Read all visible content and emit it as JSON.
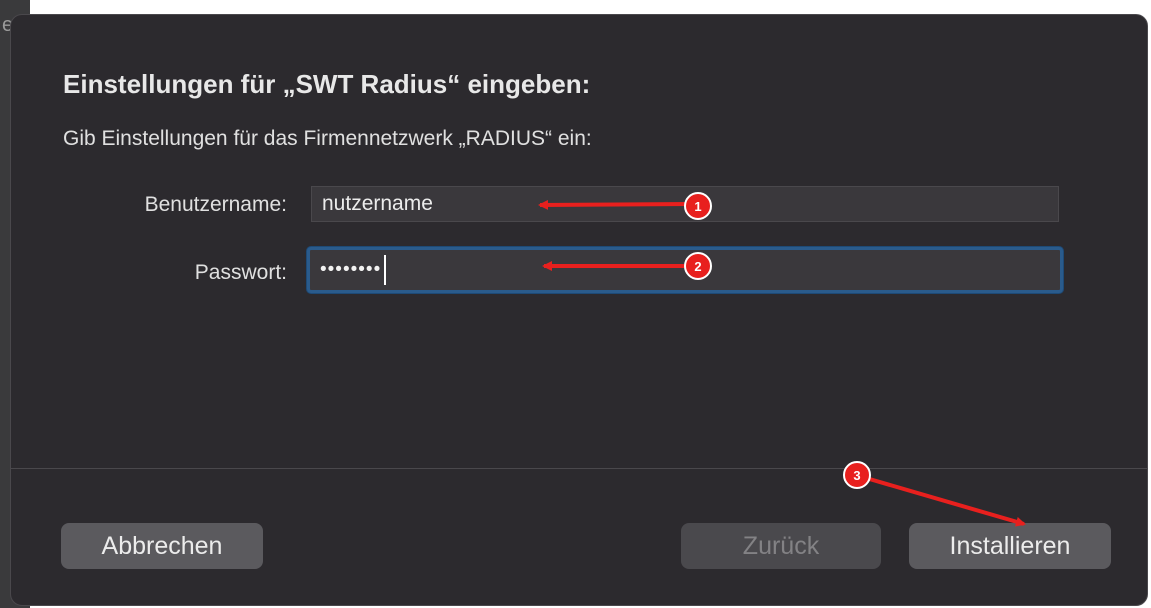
{
  "dialog": {
    "title": "Einstellungen für „SWT Radius“ eingeben:",
    "subtitle": "Gib Einstellungen für das Firmennetzwerk „RADIUS“ ein:"
  },
  "form": {
    "username_label": "Benutzername:",
    "username_value": "nutzername",
    "password_label": "Passwort:",
    "password_dots": "••••••••"
  },
  "buttons": {
    "cancel": "Abbrechen",
    "back": "Zurück",
    "install": "Installieren"
  },
  "annotations": {
    "marker_1": "1",
    "marker_2": "2",
    "marker_3": "3",
    "arrow_color": "#e8201e"
  },
  "background": {
    "edge_letter": "e"
  }
}
